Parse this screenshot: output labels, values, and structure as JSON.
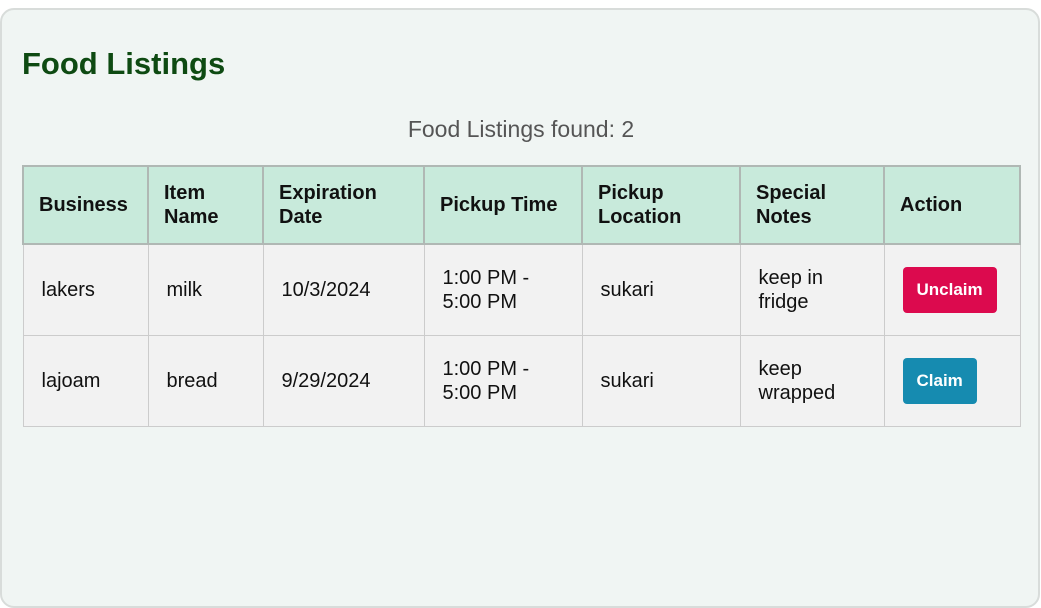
{
  "page": {
    "title": "Food Listings",
    "count_text": "Food Listings found: 2"
  },
  "table": {
    "headers": [
      "Business",
      "Item Name",
      "Expiration Date",
      "Pickup Time",
      "Pickup Location",
      "Special Notes",
      "Action"
    ],
    "rows": [
      {
        "business": "lakers",
        "item_name": "milk",
        "expiration_date": "10/3/2024",
        "pickup_time": "1:00 PM - 5:00 PM",
        "pickup_location": "sukari",
        "special_notes": "keep in fridge",
        "action_label": "Unclaim"
      },
      {
        "business": "lajoam",
        "item_name": "bread",
        "expiration_date": "9/29/2024",
        "pickup_time": "1:00 PM - 5:00 PM",
        "pickup_location": "sukari",
        "special_notes": "keep wrapped",
        "action_label": "Claim"
      }
    ]
  },
  "colors": {
    "title": "#0e4a12",
    "header_bg": "#c8eadb",
    "unclaim_button": "#dc0a4e",
    "claim_button": "#168bb0"
  }
}
